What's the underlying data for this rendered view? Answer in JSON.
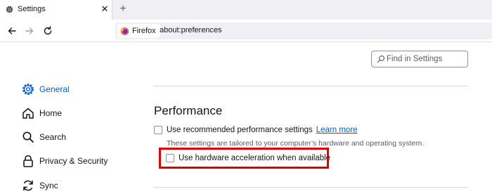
{
  "tab": {
    "label": "Settings",
    "close": "✕"
  },
  "new_tab": "+",
  "urlbar": {
    "identity_label": "Firefox",
    "url": "about:preferences"
  },
  "search": {
    "placeholder": "Find in Settings"
  },
  "sidebar": {
    "items": [
      {
        "label": "General",
        "icon": "gear-icon",
        "selected": true
      },
      {
        "label": "Home",
        "icon": "home-icon"
      },
      {
        "label": "Search",
        "icon": "search-icon"
      },
      {
        "label": "Privacy & Security",
        "icon": "lock-icon"
      },
      {
        "label": "Sync",
        "icon": "sync-icon"
      }
    ]
  },
  "performance": {
    "title": "Performance",
    "recommended_label": "Use recommended performance settings",
    "learn_more": "Learn more",
    "hint": "These settings are tailored to your computer’s hardware and operating system.",
    "hardware_label": "Use hardware acceleration when available",
    "recommended_checked": false,
    "hardware_checked": false
  },
  "colors": {
    "accent": "#0061e0",
    "highlight": "#e00000"
  }
}
